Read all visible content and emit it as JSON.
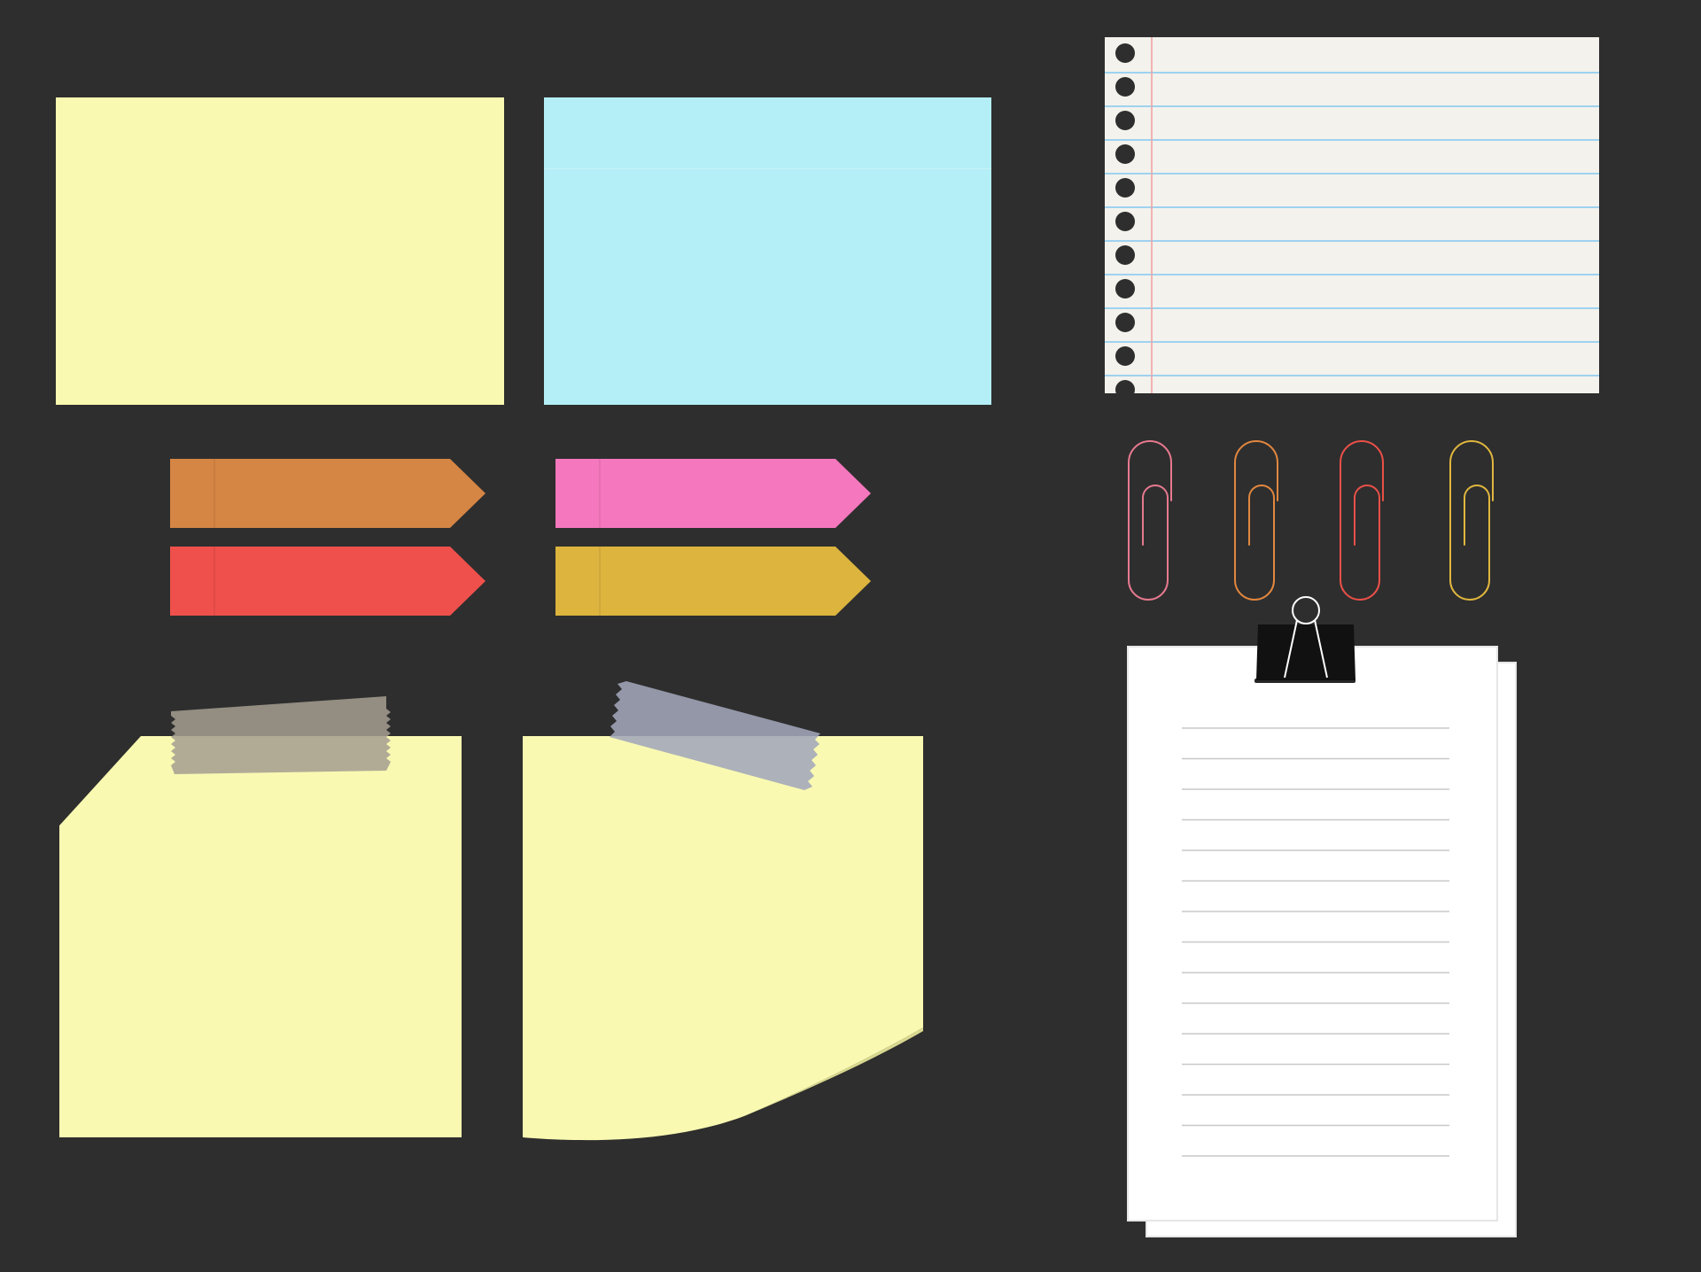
{
  "background": "#2e2e2e",
  "colors": {
    "note_yellow": "#f9f9b2",
    "note_blue": "#b4eef6",
    "notebook_paper": "#f3f2ec",
    "notebook_rule": "#9ed2f0",
    "notebook_margin": "#f0a0a0",
    "notebook_hole": "#2e2e2e",
    "clip_paper": "#ffffff",
    "clip_rule": "#c8c8c8",
    "binder": "#111111",
    "tape_gray": "#a59d91",
    "tape_blue": "#a2a6ba"
  },
  "flags": [
    {
      "name": "flag-orange",
      "color": "#d58544"
    },
    {
      "name": "flag-pink",
      "color": "#f577bd"
    },
    {
      "name": "flag-red",
      "color": "#ef504b"
    },
    {
      "name": "flag-gold",
      "color": "#dcb43e"
    }
  ],
  "paperclips": [
    {
      "name": "paperclip-pink",
      "color": "#e7798f"
    },
    {
      "name": "paperclip-orange",
      "color": "#e2873f"
    },
    {
      "name": "paperclip-red",
      "color": "#ea5048"
    },
    {
      "name": "paperclip-yellow",
      "color": "#e0b63e"
    }
  ]
}
